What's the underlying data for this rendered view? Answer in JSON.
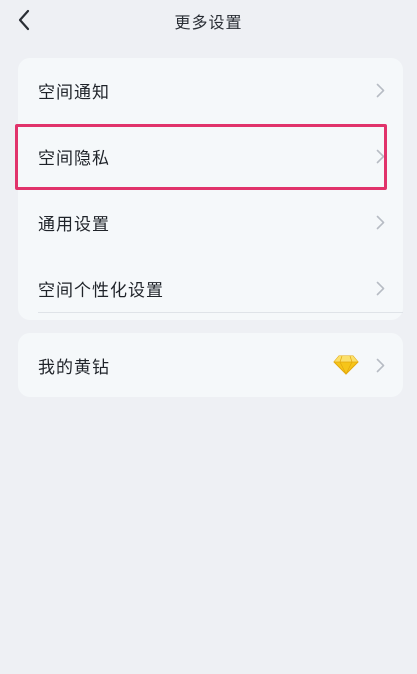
{
  "header": {
    "title": "更多设置"
  },
  "settings_group": {
    "items": [
      {
        "label": "空间通知"
      },
      {
        "label": "空间隐私"
      },
      {
        "label": "通用设置"
      },
      {
        "label": "空间个性化设置"
      }
    ]
  },
  "vip_group": {
    "label": "我的黄钻"
  },
  "colors": {
    "background": "#eef0f4",
    "card": "#f5f8fa",
    "highlight": "#e1336b",
    "diamond": "#f6c519"
  },
  "icons": {
    "back": "chevron-left-icon",
    "row": "chevron-right-icon",
    "vip": "yellow-diamond-icon"
  }
}
